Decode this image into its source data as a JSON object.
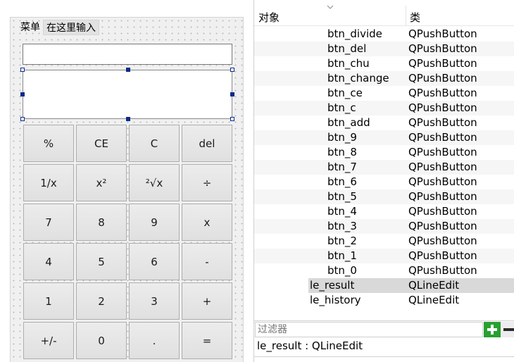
{
  "form": {
    "menu": [
      "菜单",
      "在这里输入"
    ],
    "buttons": [
      "%",
      "CE",
      "C",
      "del",
      "1/x",
      "x²",
      "²√x",
      "÷",
      "7",
      "8",
      "9",
      "x",
      "4",
      "5",
      "6",
      "-",
      "1",
      "2",
      "3",
      "+",
      "+/-",
      "0",
      ".",
      "="
    ]
  },
  "inspector": {
    "header_object": "对象",
    "header_class": "类",
    "rows": [
      {
        "object": "btn_divide",
        "class": "QPushButton",
        "level": 2
      },
      {
        "object": "btn_del",
        "class": "QPushButton",
        "level": 2
      },
      {
        "object": "btn_chu",
        "class": "QPushButton",
        "level": 2
      },
      {
        "object": "btn_change",
        "class": "QPushButton",
        "level": 2
      },
      {
        "object": "btn_ce",
        "class": "QPushButton",
        "level": 2
      },
      {
        "object": "btn_c",
        "class": "QPushButton",
        "level": 2
      },
      {
        "object": "btn_add",
        "class": "QPushButton",
        "level": 2
      },
      {
        "object": "btn_9",
        "class": "QPushButton",
        "level": 2
      },
      {
        "object": "btn_8",
        "class": "QPushButton",
        "level": 2
      },
      {
        "object": "btn_7",
        "class": "QPushButton",
        "level": 2
      },
      {
        "object": "btn_6",
        "class": "QPushButton",
        "level": 2
      },
      {
        "object": "btn_5",
        "class": "QPushButton",
        "level": 2
      },
      {
        "object": "btn_4",
        "class": "QPushButton",
        "level": 2
      },
      {
        "object": "btn_3",
        "class": "QPushButton",
        "level": 2
      },
      {
        "object": "btn_2",
        "class": "QPushButton",
        "level": 2
      },
      {
        "object": "btn_1",
        "class": "QPushButton",
        "level": 2
      },
      {
        "object": "btn_0",
        "class": "QPushButton",
        "level": 2
      },
      {
        "object": "le_result",
        "class": "QLineEdit",
        "level": 1,
        "selected": true
      },
      {
        "object": "le_history",
        "class": "QLineEdit",
        "level": 1
      }
    ],
    "filter_placeholder": "过滤器",
    "status": "le_result : QLineEdit"
  },
  "colors": {
    "accent_add": "#28a030",
    "selection": "#d9d9d9",
    "handle": "#0a2a8a"
  },
  "icons": [
    "sort-chevron-icon",
    "add-icon",
    "remove-icon"
  ]
}
